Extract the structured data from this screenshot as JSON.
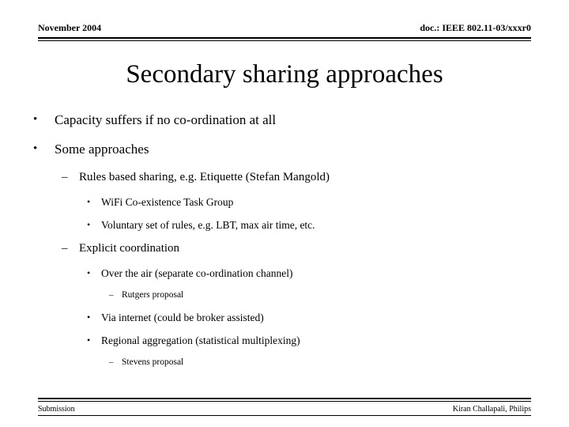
{
  "document": {
    "type": "presentation-slide",
    "background_color": "#ffffff",
    "text_color": "#000000"
  },
  "header": {
    "date": "November 2004",
    "doc_reference": "doc.: IEEE 802.11-03/xxxr0"
  },
  "title": "Secondary sharing approaches",
  "content": {
    "items": [
      {
        "level": 1,
        "marker": "•",
        "text": "Capacity suffers if no co-ordination at all"
      },
      {
        "level": 1,
        "marker": "•",
        "text": "Some approaches"
      },
      {
        "level": 2,
        "marker": "–",
        "text": "Rules based sharing, e.g. Etiquette (Stefan Mangold)"
      },
      {
        "level": 3,
        "marker": "•",
        "text": "WiFi Co-existence Task Group"
      },
      {
        "level": 3,
        "marker": "•",
        "text": "Voluntary set of rules, e.g. LBT, max air time, etc."
      },
      {
        "level": 2,
        "marker": "–",
        "text": "Explicit coordination"
      },
      {
        "level": 3,
        "marker": "•",
        "text": "Over the air (separate co-ordination channel)"
      },
      {
        "level": 4,
        "marker": "–",
        "text": "Rutgers proposal"
      },
      {
        "level": 3,
        "marker": "•",
        "text": "Via internet (could be broker assisted)"
      },
      {
        "level": 3,
        "marker": "•",
        "text": "Regional aggregation (statistical multiplexing)"
      },
      {
        "level": 4,
        "marker": "–",
        "text": "Stevens proposal"
      }
    ]
  },
  "footer": {
    "left": "Submission",
    "right": "Kiran Challapali, Philips"
  }
}
